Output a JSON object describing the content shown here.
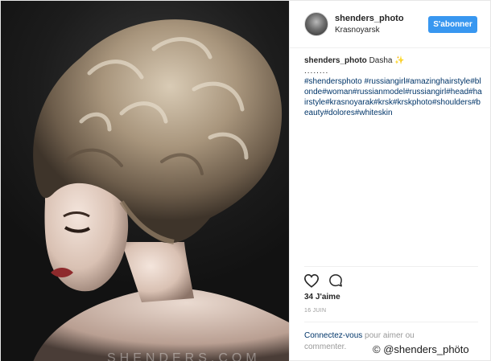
{
  "photo": {
    "alt_subject": "portrait with voluminous updo",
    "watermark_text": "SHENDERS.COM"
  },
  "header": {
    "username": "shenders_photo",
    "location": "Krasnoyarsk",
    "follow_label": "S'abonner"
  },
  "caption": {
    "username": "shenders_photo",
    "text": "Dasha",
    "emoji": "✨",
    "dots": "........",
    "hashtags": "#shendersphoto #russiangirl#amazinghairstyle#blonde#woman#russianmodel#russiangirl#head#hairstyle#krasnoyarak#krsk#krskphoto#shoulders#beauty#dolores#whiteskin"
  },
  "actions": {
    "likes": "34 J'aime",
    "date": "16 JUIN"
  },
  "comment": {
    "link_text": "Connectez-vous",
    "rest_text": " pour aimer ou commenter."
  },
  "credit": {
    "text": "© @shenders_phöto"
  },
  "colors": {
    "follow_button": "#3897f0",
    "hashtag": "#003569",
    "muted": "#999999"
  }
}
